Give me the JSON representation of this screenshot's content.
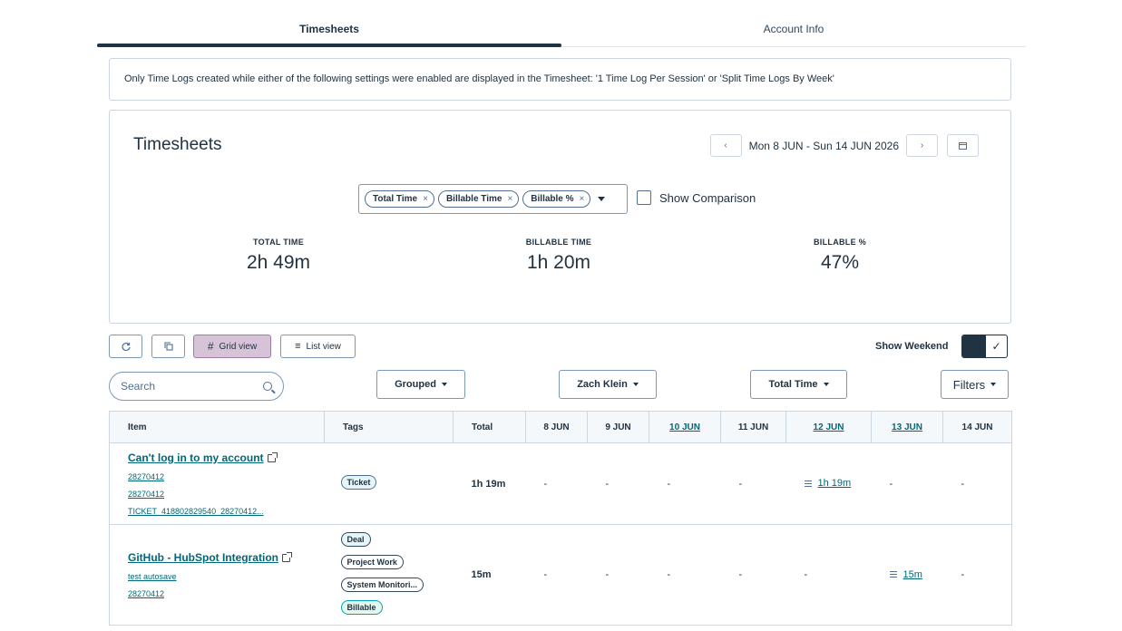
{
  "tabs": [
    {
      "label": "Timesheets",
      "active": true
    },
    {
      "label": "Account Info",
      "active": false
    }
  ],
  "notice": "Only Time Logs created while either of the following settings were enabled are displayed in the Timesheet: '1 Time Log Per Session' or 'Split Time Logs By Week'",
  "summary": {
    "title": "Timesheets",
    "date_range": "Mon 8 JUN - Sun 14 JUN 2026",
    "metric_pills": [
      "Total Time",
      "Billable Time",
      "Billable %"
    ],
    "show_comparison_label": "Show Comparison",
    "stats": [
      {
        "label": "TOTAL TIME",
        "value": "2h 49m"
      },
      {
        "label": "BILLABLE TIME",
        "value": "1h 20m"
      },
      {
        "label": "BILLABLE %",
        "value": "47%"
      }
    ]
  },
  "toolbar": {
    "grid_view": "Grid view",
    "list_view": "List view",
    "show_weekend": "Show Weekend"
  },
  "filters": {
    "search_placeholder": "Search",
    "grouped": "Grouped",
    "user": "Zach Klein",
    "metric": "Total Time",
    "filters": "Filters"
  },
  "table": {
    "headers": {
      "item": "Item",
      "tags": "Tags",
      "total": "Total",
      "days": [
        "8 JUN",
        "9 JUN",
        "10 JUN",
        "11 JUN",
        "12 JUN",
        "13 JUN",
        "14 JUN"
      ]
    },
    "rows": [
      {
        "title": "Can't log in to my account",
        "links": [
          "28270412",
          "28270412",
          "TICKET_418802829540_28270412..."
        ],
        "tags": [
          "Ticket"
        ],
        "total": "1h 19m",
        "days": [
          "-",
          "-",
          "-",
          "-",
          "1h 19m",
          "-",
          "-"
        ]
      },
      {
        "title": "GitHub - HubSpot Integration",
        "links": [
          "test autosave",
          "28270412"
        ],
        "tags": [
          "Deal",
          "Project Work",
          "System Monitori...",
          "Billable"
        ],
        "total": "15m",
        "days": [
          "-",
          "-",
          "-",
          "-",
          "-",
          "15m",
          "-"
        ]
      }
    ]
  },
  "colors": {
    "accent_link": "#00677a",
    "grid_view_active": "#d7c3d8",
    "text_dark": "#213343"
  }
}
